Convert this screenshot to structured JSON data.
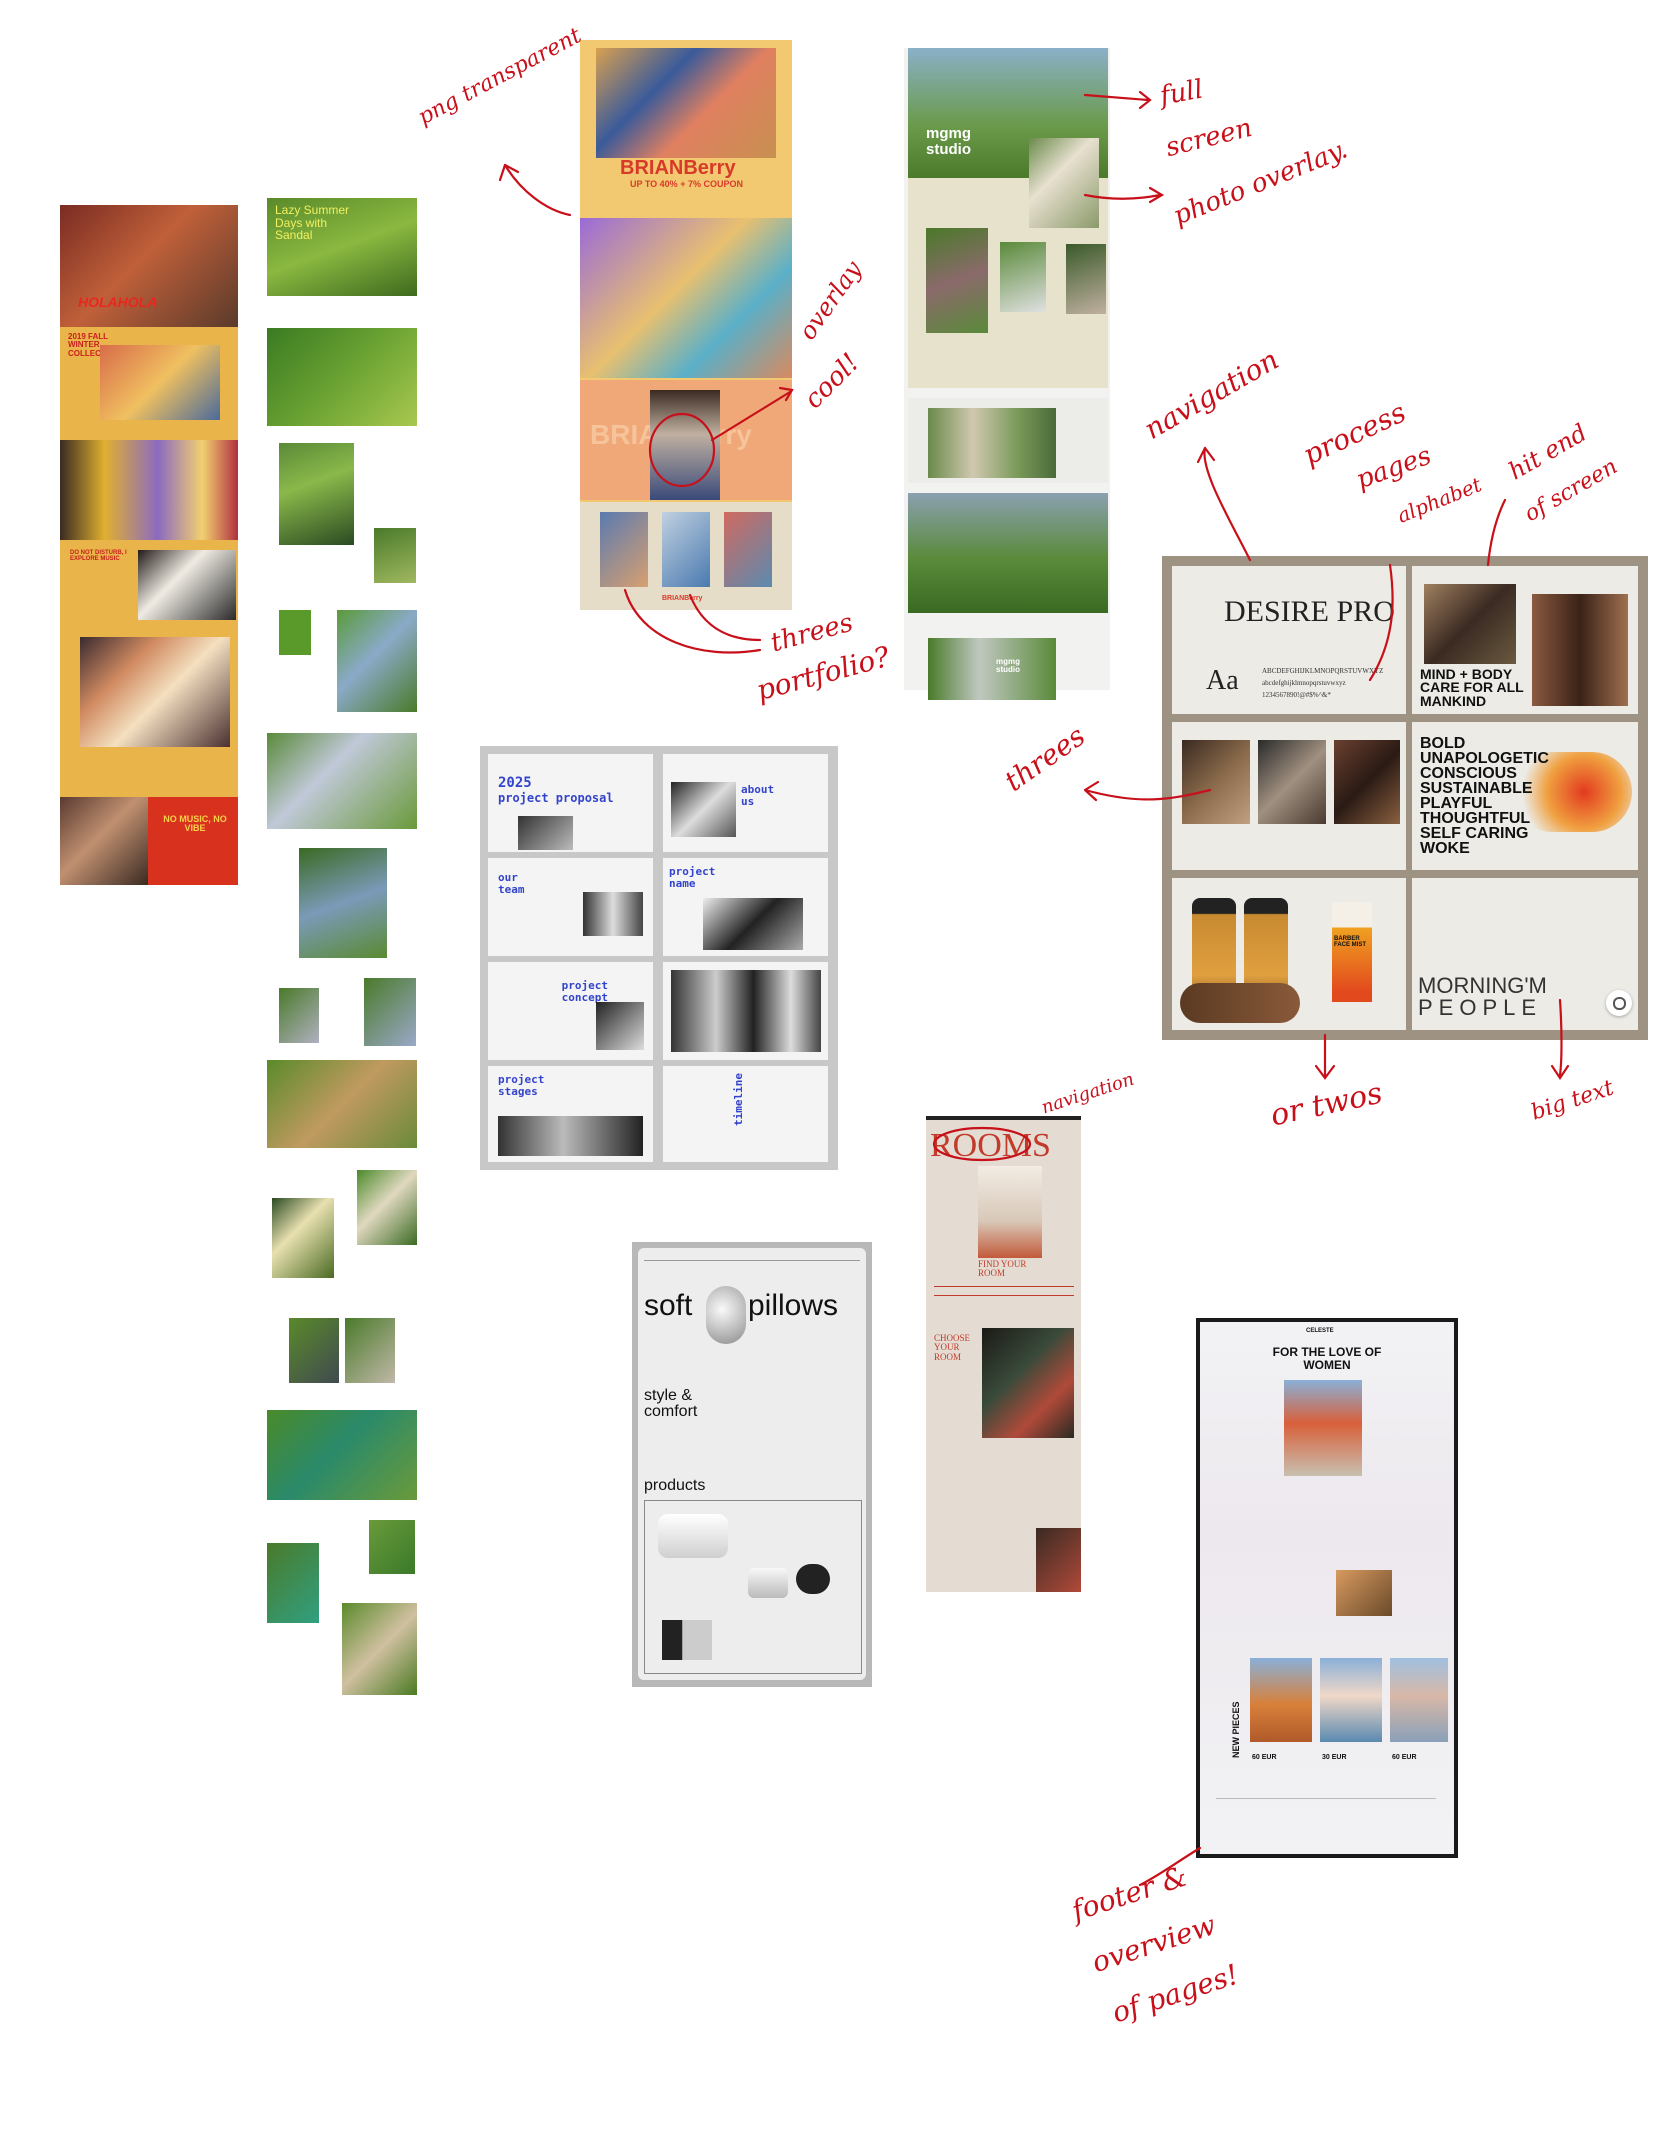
{
  "annotations": {
    "png_transparent": "png transparent",
    "full_screen_overlay_1": "full",
    "full_screen_overlay_2": "screen",
    "full_screen_overlay_3": "photo overlay.",
    "overlay_cool_1": "overlay",
    "overlay_cool_2": "cool!",
    "threes_portfolio_1": "threes",
    "threes_portfolio_2": "portfolio?",
    "navigation": "navigation",
    "process_pages_1": "process",
    "process_pages_2": "pages",
    "process_pages_3": "alphabet",
    "hit_end_1": "hit end",
    "hit_end_2": "of screen",
    "threes": "threes",
    "or_twos": "or twos",
    "big_text": "big text",
    "navigation_2": "navigation",
    "footer_1": "footer &",
    "footer_2": "overview",
    "footer_3": "of pages!"
  },
  "board1": {
    "title": "HOLAHOLA",
    "collection": "2019 FALL WINTER COLLECTION",
    "tagline": "DO NOT DISTURB, I EXPLORE MUSIC",
    "no_music": "NO MUSIC, NO VIBE"
  },
  "board2": {
    "title": "Lazy Summer Days with Sandal"
  },
  "board3": {
    "brand": "BRIANBerry",
    "promo": "UP TO 40% + 7% COUPON",
    "brand_footer": "BRIANBerry"
  },
  "board4": {
    "title": "mgmg studio",
    "sub": "mgmg studio"
  },
  "board5": {
    "t1": "2025",
    "t2": "project proposal",
    "t3": "about us",
    "t4": "our team",
    "t5": "project name",
    "t6": "project concept",
    "t7": "project stages",
    "t8": "timeline"
  },
  "board6": {
    "font_name": "DESIRE PRO",
    "aa": "Aa",
    "alphabet_upper": "ABCDEFGHIJKLMNOPQRSTUVWXYZ",
    "alphabet_lower": "abcdefghijklmnopqrstuvwxyz",
    "digits": "1234567890!@#$%^&*",
    "mind_body": "MIND + BODY CARE FOR ALL MANKIND",
    "bold_list": [
      "BOLD",
      "UNAPOLOGETIC",
      "CONSCIOUS",
      "SUSTAINABLE",
      "PLAYFUL",
      "THOUGHTFUL",
      "SELF CARING",
      "WOKE"
    ],
    "morning": "MORNING'M",
    "people": "PEOPLE",
    "product_label": "BARBER FACE MIST"
  },
  "board7": {
    "word1": "soft",
    "word2": "pillows",
    "style": "style &",
    "comfort": "comfort",
    "products": "products"
  },
  "board8": {
    "rooms": "ROOMS",
    "find_room": "FIND YOUR ROOM",
    "choose_room": "CHOOSE YOUR ROOM"
  },
  "board9": {
    "brand": "CELESTE",
    "headline": "FOR THE LOVE OF WOMEN",
    "new_pieces": "NEW PIECES",
    "price1": "60 EUR",
    "price2": "30 EUR",
    "price3": "60 EUR"
  },
  "colors": {
    "annotation_red": "#c8101a",
    "blue_accent": "#3344cc",
    "rooms_red": "#c23a2a"
  }
}
